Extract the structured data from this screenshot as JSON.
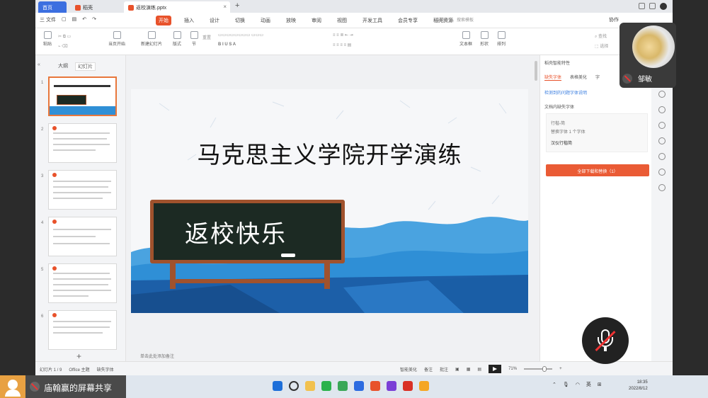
{
  "window": {
    "tabs": [
      {
        "label": "首页"
      },
      {
        "label": "稻壳"
      },
      {
        "label": "返校演练.pptx"
      }
    ]
  },
  "menubar": {
    "file_label": "三 文件",
    "tabs": [
      "开始",
      "插入",
      "设计",
      "切换",
      "动画",
      "放映",
      "审阅",
      "视图",
      "开发工具",
      "会员专享",
      "稻壳资源"
    ],
    "active_tab": "开始",
    "search_placeholder": "查找命令、搜索模板",
    "right": "协作"
  },
  "ribbon": {
    "paste": "粘贴",
    "play_current": "当页开始",
    "new_slide": "新建幻灯片",
    "layout": "版式",
    "section": "节",
    "reset": "重置",
    "textbox": "文本框",
    "shape": "形状",
    "arrange": "排列",
    "find": "查找",
    "select": "选择"
  },
  "thumbnails": {
    "tabs": [
      "大纲",
      "幻灯片"
    ],
    "items": [
      {
        "num": "1"
      },
      {
        "num": "2"
      },
      {
        "num": "3"
      },
      {
        "num": "4"
      },
      {
        "num": "5"
      },
      {
        "num": "6"
      }
    ]
  },
  "slide": {
    "title": "马克思主义学院开学演练",
    "board_text": "返校快乐"
  },
  "notes": {
    "placeholder": "单击此处添加备注"
  },
  "right_panel": {
    "title": "稻壳智能特性",
    "tabs": [
      "缺失字体",
      "表格美化",
      "字"
    ],
    "link": "检测到的问题字体说明",
    "section": "文档内缺失字体",
    "card": {
      "line1": "行楷-简",
      "line2": "替换字体 1 个字体",
      "sample": "汉仪行楷简"
    },
    "button": "全部下载和替换（1）"
  },
  "statusbar": {
    "slide_info": "幻灯片 1 / 9",
    "theme": "Office 主题",
    "font_missing": "缺失字体",
    "smart": "智能美化",
    "notes": "备注",
    "comments": "批注",
    "zoom": "71%"
  },
  "video": {
    "name": "邹敏"
  },
  "taskbar": {
    "share_label": "庙翰赢的屏幕共享",
    "ime": "英",
    "time": "18:35",
    "date": "2022/8/12"
  },
  "colors": {
    "accent": "#e8522b",
    "board": "#1c2a23",
    "frame": "#a0522d",
    "wave": "#2f8fd6"
  }
}
